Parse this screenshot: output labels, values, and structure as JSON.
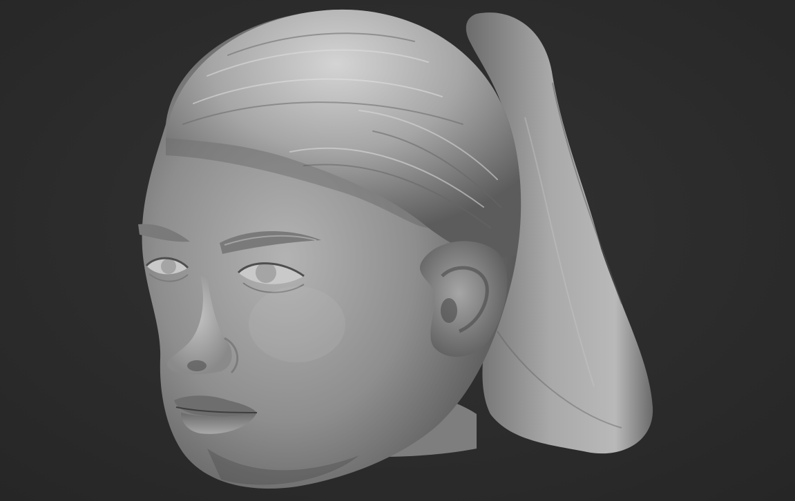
{
  "viewport": {
    "background_color": "#2c2c2c",
    "model": {
      "subject": "sculpted-head-with-ponytail",
      "base_color": "#9a9a9a",
      "highlight_color": "#d2d2d2",
      "shadow_color": "#4a4a4a"
    }
  }
}
